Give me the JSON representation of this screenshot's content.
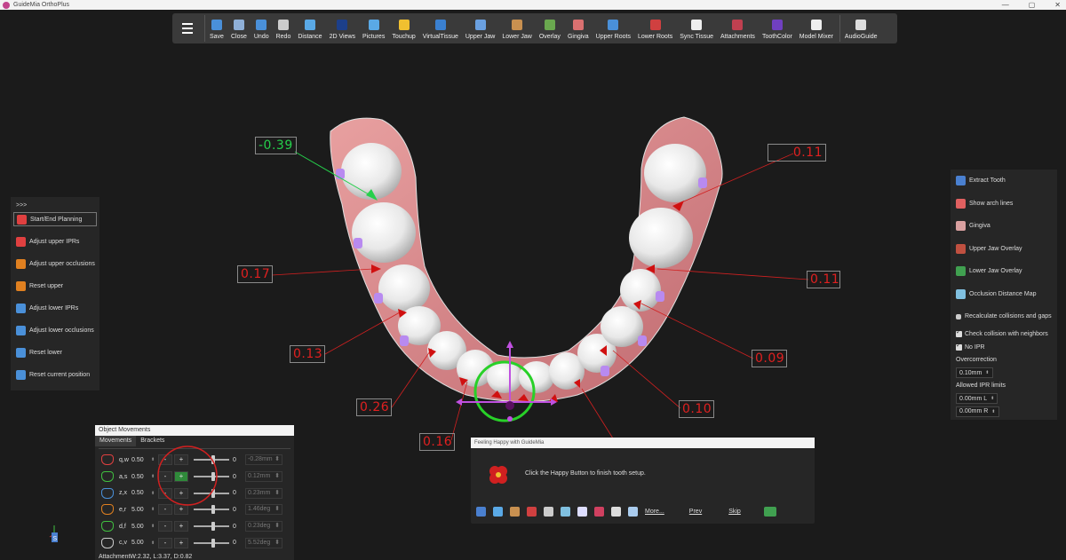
{
  "window": {
    "title": "GuideMia OrthoPlus",
    "controls": [
      "—",
      "▢",
      "✕"
    ]
  },
  "toolbar": {
    "items": [
      {
        "label": "Save",
        "icon": "save-icon",
        "color": "#4a90d9"
      },
      {
        "label": "Close",
        "icon": "close-doc-icon",
        "color": "#8fb0d8"
      },
      {
        "label": "Undo",
        "icon": "undo-icon",
        "color": "#4a90d9"
      },
      {
        "label": "Redo",
        "icon": "redo-icon",
        "color": "#cccccc"
      },
      {
        "label": "Distance",
        "icon": "ruler-icon",
        "color": "#5aa9e6"
      },
      {
        "label": "2D Views",
        "icon": "views-2d-icon",
        "color": "#1c3f8a"
      },
      {
        "label": "Pictures",
        "icon": "pictures-icon",
        "color": "#5aa9e6"
      },
      {
        "label": "Touchup",
        "icon": "touchup-icon",
        "color": "#f0c030"
      },
      {
        "label": "VirtualTissue",
        "icon": "virtual-tissue-icon",
        "color": "#3a80d0"
      },
      {
        "label": "Upper Jaw",
        "icon": "upper-jaw-icon",
        "color": "#6aa0e0"
      },
      {
        "label": "Lower Jaw",
        "icon": "lower-jaw-icon",
        "color": "#c89050"
      },
      {
        "label": "Overlay",
        "icon": "overlay-icon",
        "color": "#6aa84f"
      },
      {
        "label": "Gingiva",
        "icon": "gingiva-icon",
        "color": "#d97070"
      },
      {
        "label": "Upper Roots",
        "icon": "upper-roots-icon",
        "color": "#4a90d9"
      },
      {
        "label": "Lower Roots",
        "icon": "lower-roots-icon",
        "color": "#d04040"
      },
      {
        "label": "Sync Tissue",
        "icon": "sync-tissue-icon",
        "color": "#eeeeee"
      },
      {
        "label": "Attachments",
        "icon": "attachments-icon",
        "color": "#c04050"
      },
      {
        "label": "ToothColor",
        "icon": "tooth-color-icon",
        "color": "#7040c0"
      },
      {
        "label": "Model Mixer",
        "icon": "model-mixer-icon",
        "color": "#eeeeee"
      },
      {
        "label": "AudioGuide",
        "icon": "audio-guide-icon",
        "color": "#dddddd"
      }
    ]
  },
  "ipr_labels": [
    {
      "text": "-0.39",
      "color": "green"
    },
    {
      "text": "0.11",
      "color": "red"
    },
    {
      "text": "0.17",
      "color": "red"
    },
    {
      "text": "0.11",
      "color": "red"
    },
    {
      "text": "0.13",
      "color": "red"
    },
    {
      "text": "0.09",
      "color": "red"
    },
    {
      "text": "0.26",
      "color": "red"
    },
    {
      "text": "0.10",
      "color": "red"
    },
    {
      "text": "0.16",
      "color": "red"
    }
  ],
  "left_panel": {
    "header": ">>>",
    "items": [
      {
        "label": "Start/End Planning",
        "icon": "planning-icon",
        "color": "#e04040"
      },
      {
        "label": "Adjust upper IPRs",
        "icon": "upper-ipr-icon",
        "color": "#e04040"
      },
      {
        "label": "Adjust upper occlusions",
        "icon": "upper-occlusion-icon",
        "color": "#e08020"
      },
      {
        "label": "Reset upper",
        "icon": "reset-upper-icon",
        "color": "#e08020"
      },
      {
        "label": "Adjust lower IPRs",
        "icon": "lower-ipr-icon",
        "color": "#4a90d9"
      },
      {
        "label": "Adjust lower occlusions",
        "icon": "lower-occlusion-icon",
        "color": "#4a90d9"
      },
      {
        "label": "Reset lower",
        "icon": "reset-lower-icon",
        "color": "#4a90d9"
      },
      {
        "label": "Reset current position",
        "icon": "reset-current-icon",
        "color": "#4a90d9"
      }
    ]
  },
  "right_panel": {
    "items": [
      {
        "label": "Extract Tooth",
        "icon": "extract-tooth-icon",
        "color": "#4a80d0"
      },
      {
        "label": "Show arch lines",
        "icon": "arch-lines-icon",
        "color": "#e06060"
      },
      {
        "label": "Gingiva",
        "icon": "gingiva-icon",
        "color": "#d9a0a0"
      },
      {
        "label": "Upper Jaw Overlay",
        "icon": "upper-overlay-icon",
        "color": "#c05040"
      },
      {
        "label": "Lower Jaw Overlay",
        "icon": "lower-overlay-icon",
        "color": "#40a050"
      },
      {
        "label": "Occlusion Distance Map",
        "icon": "distance-map-icon",
        "color": "#80c0e0"
      },
      {
        "label": "Recalculate collisions and gaps",
        "icon": "recalculate-icon",
        "color": "#cccccc"
      }
    ],
    "check_collision": "Check collision with neighbors",
    "no_ipr": "No IPR",
    "overcorrection_label": "Overcorrection",
    "overcorrection_value": "0.10mm",
    "ipr_limits_label": "Allowed IPR limits",
    "ipr_limit_l": "0.00mm L",
    "ipr_limit_r": "0.00mm R"
  },
  "object_movements": {
    "title": "Object Movements",
    "tabs": [
      "Movements",
      "Brackets"
    ],
    "rows": [
      {
        "code": "q,w",
        "step": "0.50",
        "minus": "-",
        "plus": "+",
        "zero": "0",
        "result": "-0.28mm",
        "icon": "tooth-tip-icon",
        "color": "#e04040",
        "knob": 0.5
      },
      {
        "code": "a,s",
        "step": "0.50",
        "minus": "-",
        "plus": "+",
        "zero": "0",
        "result": "0.12mm",
        "icon": "tooth-torque-icon",
        "color": "#40c040",
        "knob": 0.5
      },
      {
        "code": "z,x",
        "step": "0.50",
        "minus": "-",
        "plus": "+",
        "zero": "0",
        "result": "0.23mm",
        "icon": "tooth-intrude-icon",
        "color": "#4a90d9",
        "knob": 0.5
      },
      {
        "code": "e,r",
        "step": "5.00",
        "minus": "-",
        "plus": "+",
        "zero": "0",
        "result": "1.46deg",
        "icon": "tooth-rotate-icon",
        "color": "#e08020",
        "knob": 0.5
      },
      {
        "code": "d,f",
        "step": "5.00",
        "minus": "-",
        "plus": "+",
        "zero": "0",
        "result": "0.23deg",
        "icon": "tooth-angulation-icon",
        "color": "#40c040",
        "knob": 0.5
      },
      {
        "code": "c,v",
        "step": "5.00",
        "minus": "-",
        "plus": "+",
        "zero": "0",
        "result": "5.52deg",
        "icon": "tooth-inclination-icon",
        "color": "#cccccc",
        "knob": 0.5
      }
    ],
    "footer": "AttachmentW:2.32, L:3.37, D:0.82"
  },
  "happy_dialog": {
    "title": "Feeling Happy with GuideMia",
    "message": "Click the Happy Button to finish tooth setup.",
    "more": "More...",
    "prev": "Prev",
    "skip": "Skip"
  }
}
